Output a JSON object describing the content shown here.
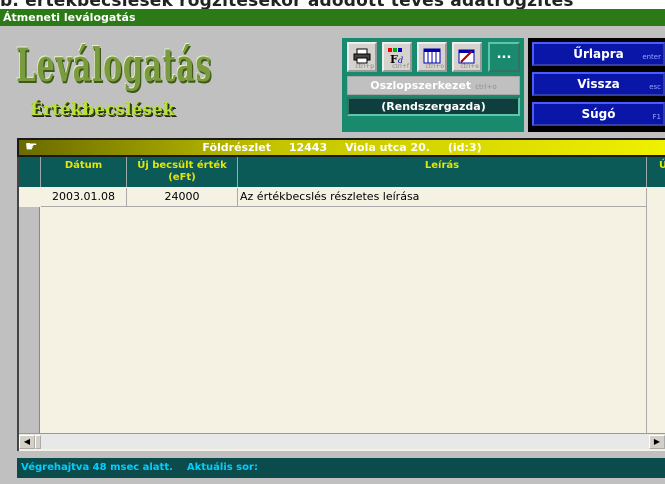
{
  "background_text": "b. értékbecslések rögzítésekor adódott téves adatrögzítés",
  "window": {
    "title": "Átmeneti leválogatás"
  },
  "header": {
    "title": "Leválogatás",
    "subtitle": "Értékbecslések"
  },
  "toolbar": {
    "buttons": [
      {
        "icon": "printer-icon",
        "hint": "ctrl+p"
      },
      {
        "icon": "font-icon",
        "hint": "ctrl+f"
      },
      {
        "icon": "columns-icon",
        "hint": "ctrl+o"
      },
      {
        "icon": "edit-form-icon",
        "hint": "ctrl+e"
      }
    ],
    "more_label": "...",
    "column_structure_label": "Oszlopszerkezet",
    "column_structure_hint": "ctrl+o",
    "user_label": "(Rendszergazda)"
  },
  "nav": {
    "form_label": "Űrlapra",
    "form_hint": "enter",
    "back_label": "Vissza",
    "back_hint": "esc",
    "help_label": "Súgó",
    "help_hint": "F1"
  },
  "record": {
    "parcel_label": "Földrészlet",
    "parcel_number": "12443",
    "street": "Viola utca 20.",
    "id": "(id:3)"
  },
  "table": {
    "columns": [
      "Dátum",
      "Új becsült érték (eFt)",
      "Leírás",
      "Ú"
    ],
    "rows": [
      {
        "date": "2003.01.08",
        "value": "24000",
        "description": "Az értékbecslés részletes leírása"
      }
    ]
  },
  "status": {
    "exec_label": "Végrehajtva 48 msec alatt.",
    "current_row_label": "Aktuális sor:"
  },
  "colors": {
    "titlebar": "#2b7a17",
    "toolpanel": "#1a8a6e",
    "navpanel": "#0a16a8",
    "grid_header": "#0b5a58",
    "grid_header_text": "#e6e600",
    "status_bg": "#0b4b4b",
    "status_text": "#00d0ff"
  }
}
